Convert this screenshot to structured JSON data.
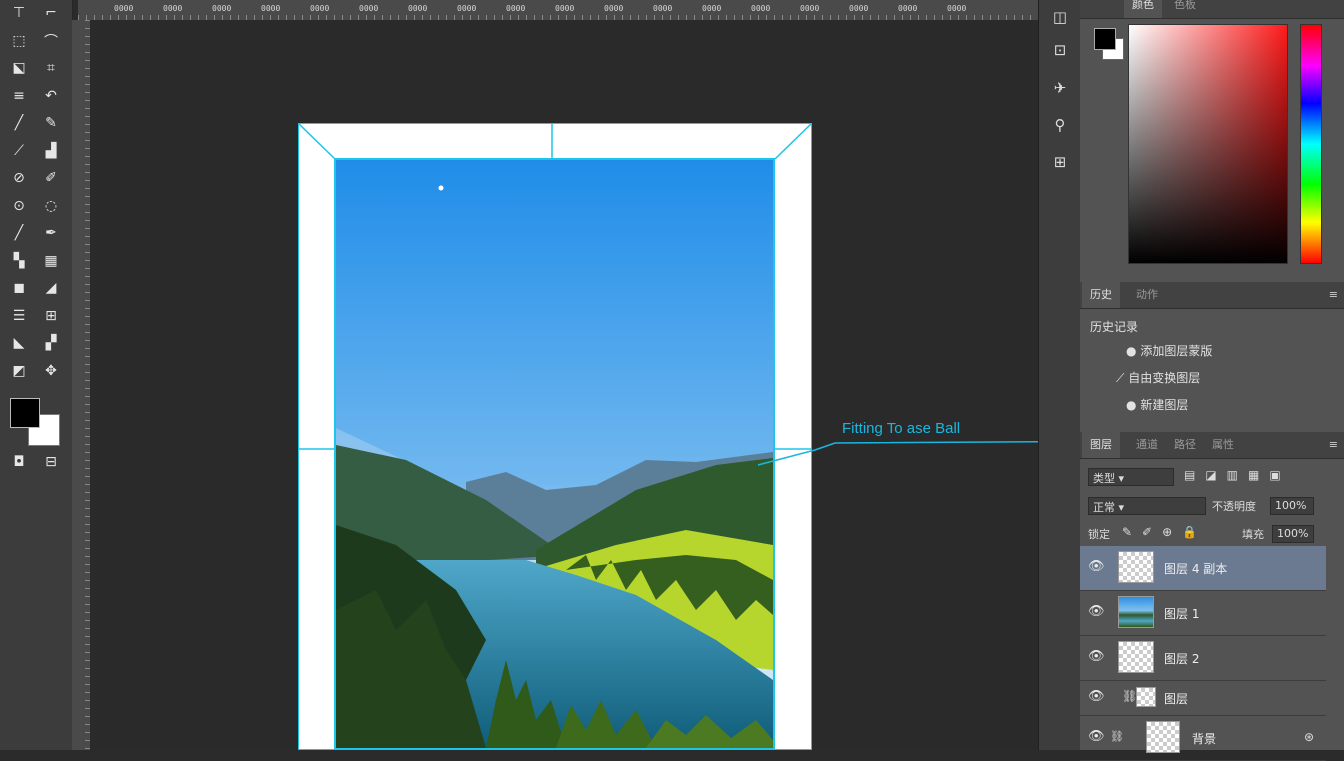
{
  "ruler": {
    "ticks": [
      "0000",
      "0000",
      "0000",
      "0000",
      "0000",
      "0000",
      "0000",
      "0000",
      "0000",
      "0000",
      "0000",
      "0000",
      "0000",
      "0000",
      "0000",
      "0000",
      "0000",
      "0000"
    ]
  },
  "toolbar": {
    "tools": [
      {
        "name": "move-tool-icon",
        "glyph": "⊤"
      },
      {
        "name": "artboard-tool-icon",
        "glyph": "⌐"
      },
      {
        "name": "marquee-tool-icon",
        "glyph": "⬚"
      },
      {
        "name": "lasso-tool-icon",
        "glyph": "⌒"
      },
      {
        "name": "quick-select-icon",
        "glyph": "⬕"
      },
      {
        "name": "crop-tool-icon",
        "glyph": "⌗"
      },
      {
        "name": "frame-tool-icon",
        "glyph": "≡"
      },
      {
        "name": "eyedropper-icon",
        "glyph": "↶"
      },
      {
        "name": "brush-tool-icon",
        "glyph": "╱"
      },
      {
        "name": "pencil-tool-icon",
        "glyph": "✎"
      },
      {
        "name": "heal-tool-icon",
        "glyph": "⟋"
      },
      {
        "name": "stamp-tool-icon",
        "glyph": "▟"
      },
      {
        "name": "history-brush-icon",
        "glyph": "⊘"
      },
      {
        "name": "eraser-tool-icon",
        "glyph": "✐"
      },
      {
        "name": "gradient-tool-icon",
        "glyph": "⊙"
      },
      {
        "name": "blur-tool-icon",
        "glyph": "◌"
      },
      {
        "name": "dodge-tool-icon",
        "glyph": "╱"
      },
      {
        "name": "pen-tool-icon",
        "glyph": "✒"
      },
      {
        "name": "type-tool-icon",
        "glyph": "▚"
      },
      {
        "name": "path-select-icon",
        "glyph": "▦"
      },
      {
        "name": "shape-tool-icon",
        "glyph": "◼"
      },
      {
        "name": "hand-tool-icon",
        "glyph": "◢"
      },
      {
        "name": "zoom-tool-icon",
        "glyph": "☰"
      },
      {
        "name": "edit-toolbar-icon",
        "glyph": "⊞"
      },
      {
        "name": "rotate-view-icon",
        "glyph": "◣"
      },
      {
        "name": "extra-tool-icon",
        "glyph": "▞"
      },
      {
        "name": "note-tool-icon",
        "glyph": "◩"
      },
      {
        "name": "count-tool-icon",
        "glyph": "✥"
      }
    ],
    "quick_mask_glyph": "◘",
    "screen_mode_glyph": "⊟"
  },
  "side_icons": [
    "◫",
    "⊡",
    "✈",
    "⚲",
    "⊞"
  ],
  "color_panel": {
    "tabs": [
      "颜色",
      "色板"
    ],
    "foreground": "#000000",
    "background": "#ffffff",
    "hue_color": "#ff1a1a"
  },
  "history_panel": {
    "tabs": [
      "历史",
      "动作"
    ],
    "header": "历史记录",
    "items": [
      {
        "icon": "●",
        "label": "添加图层蒙版"
      },
      {
        "icon": "⟋",
        "label": "自由变换图层"
      },
      {
        "icon": "●",
        "label": "新建图层"
      }
    ]
  },
  "layers_panel": {
    "tabs": [
      "图层",
      "通道",
      "路径",
      "属性"
    ],
    "filter_label": "类型",
    "blend_mode": "正常",
    "opacity_label": "不透明度",
    "opacity_value": "100%",
    "lock_label": "锁定",
    "fill_label": "填充",
    "fill_value": "100%",
    "layers": [
      {
        "name": "图层 4 副本",
        "type": "transparent",
        "selected": true
      },
      {
        "name": "图层 1",
        "type": "photo",
        "selected": false
      },
      {
        "name": "图层 2",
        "type": "transparent",
        "selected": false
      },
      {
        "name": "图层",
        "type": "mask",
        "selected": false
      },
      {
        "name": "背景",
        "type": "transparent",
        "selected": false
      }
    ]
  },
  "annotation": {
    "text": "Fitting To ase Ball",
    "color": "#19b7e0"
  }
}
